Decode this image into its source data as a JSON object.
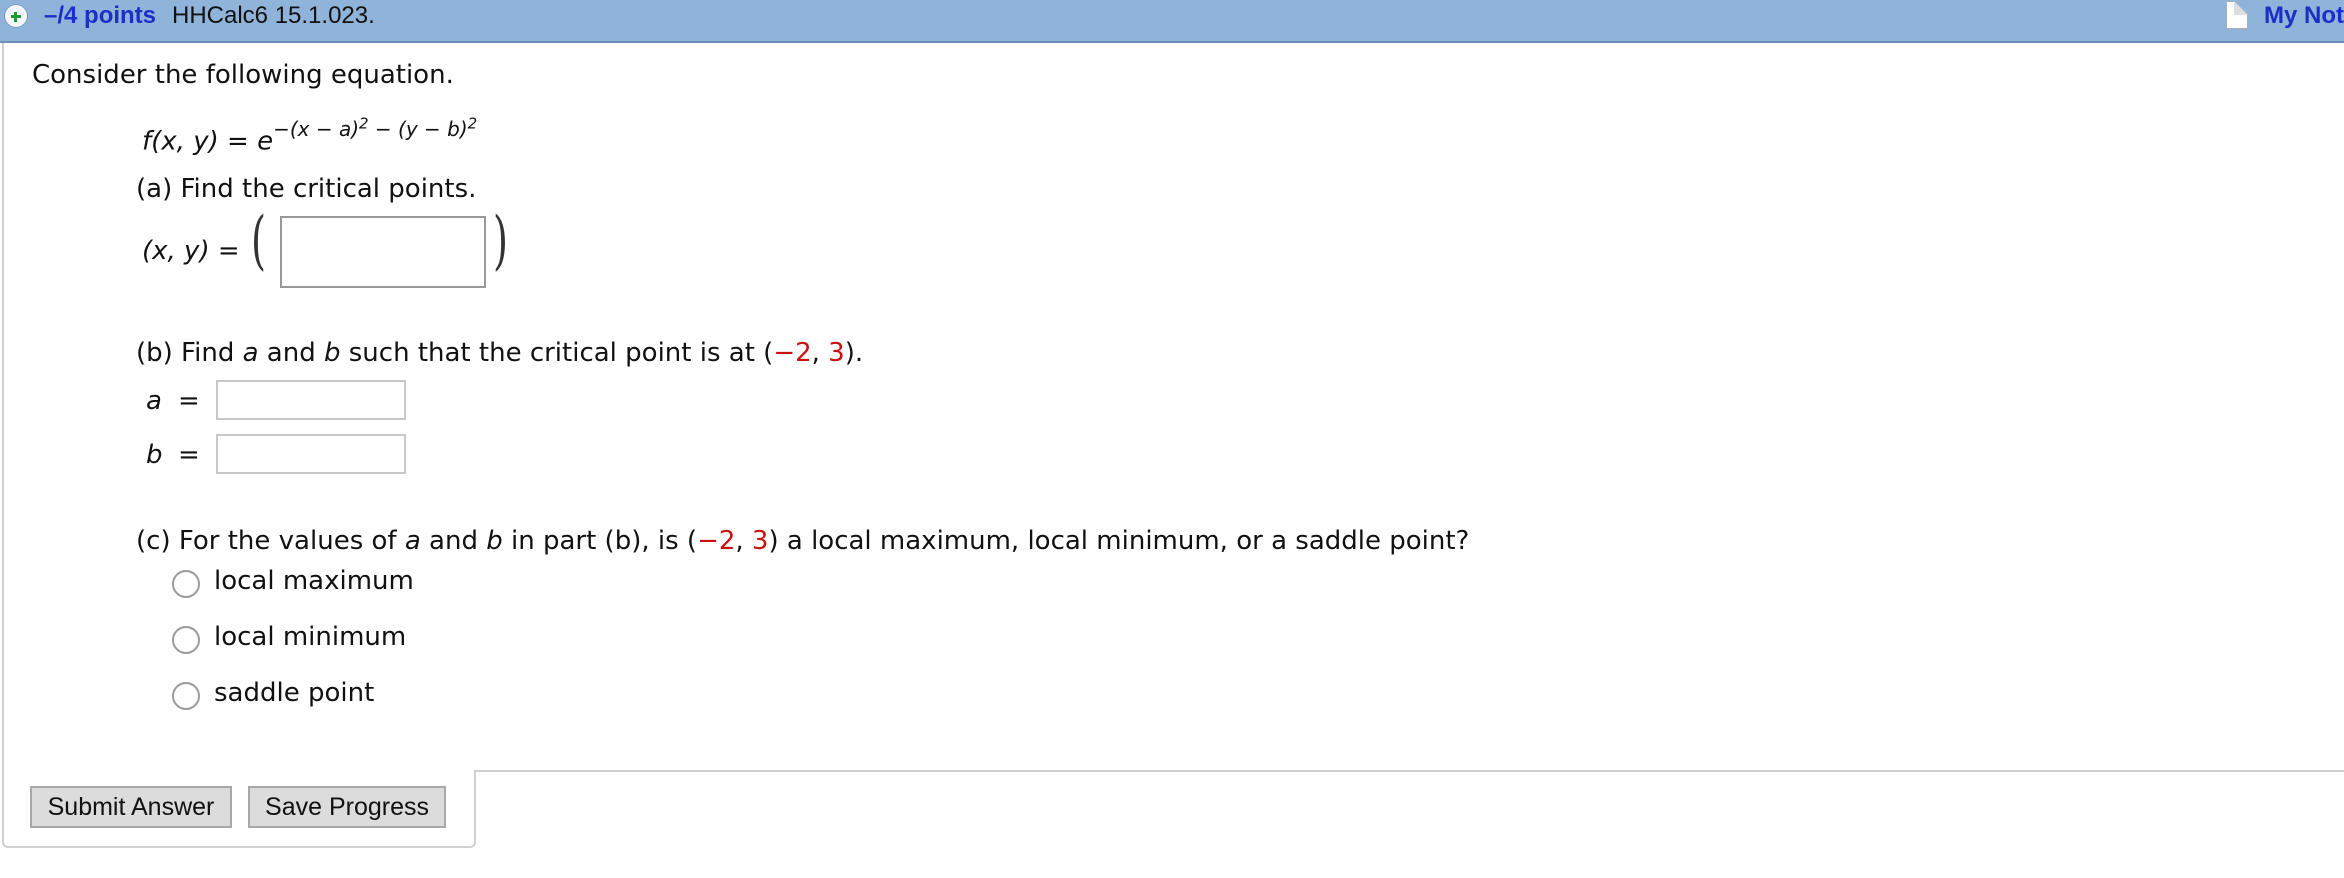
{
  "header": {
    "points": "–/4 points",
    "problem_id": "HHCalc6 15.1.023.",
    "my_notes": "My Not"
  },
  "problem": {
    "intro": "Consider the following equation.",
    "equation": {
      "lhs": "f(x, y)",
      "equals": "=",
      "base": "e",
      "exponent_parts": [
        "−(x − a)",
        "2",
        " − (y − b)",
        "2"
      ]
    },
    "part_a": {
      "prompt": "(a) Find the critical points.",
      "lhs": "(x, y)  =",
      "input_value": ""
    },
    "part_b": {
      "prompt_parts": [
        "(b) Find ",
        "a",
        " and ",
        "b",
        " such that the critical point is at  (",
        "−2",
        ", ",
        "3",
        ")."
      ],
      "a_label": "a",
      "b_label": "b",
      "equals": "=",
      "a_value": "",
      "b_value": ""
    },
    "part_c": {
      "prompt_parts": [
        "(c) For the values of ",
        "a",
        " and ",
        "b",
        " in part (b), is  (",
        "−2",
        ", ",
        "3",
        ")  a local maximum, local minimum, or a saddle point?"
      ],
      "options": [
        "local maximum",
        "local minimum",
        "saddle point"
      ]
    }
  },
  "buttons": {
    "submit": "Submit Answer",
    "save": "Save Progress"
  },
  "colors": {
    "header_bg": "#8fb3d9",
    "link_blue": "#1a2ec8",
    "highlight_red": "#cc1111"
  }
}
